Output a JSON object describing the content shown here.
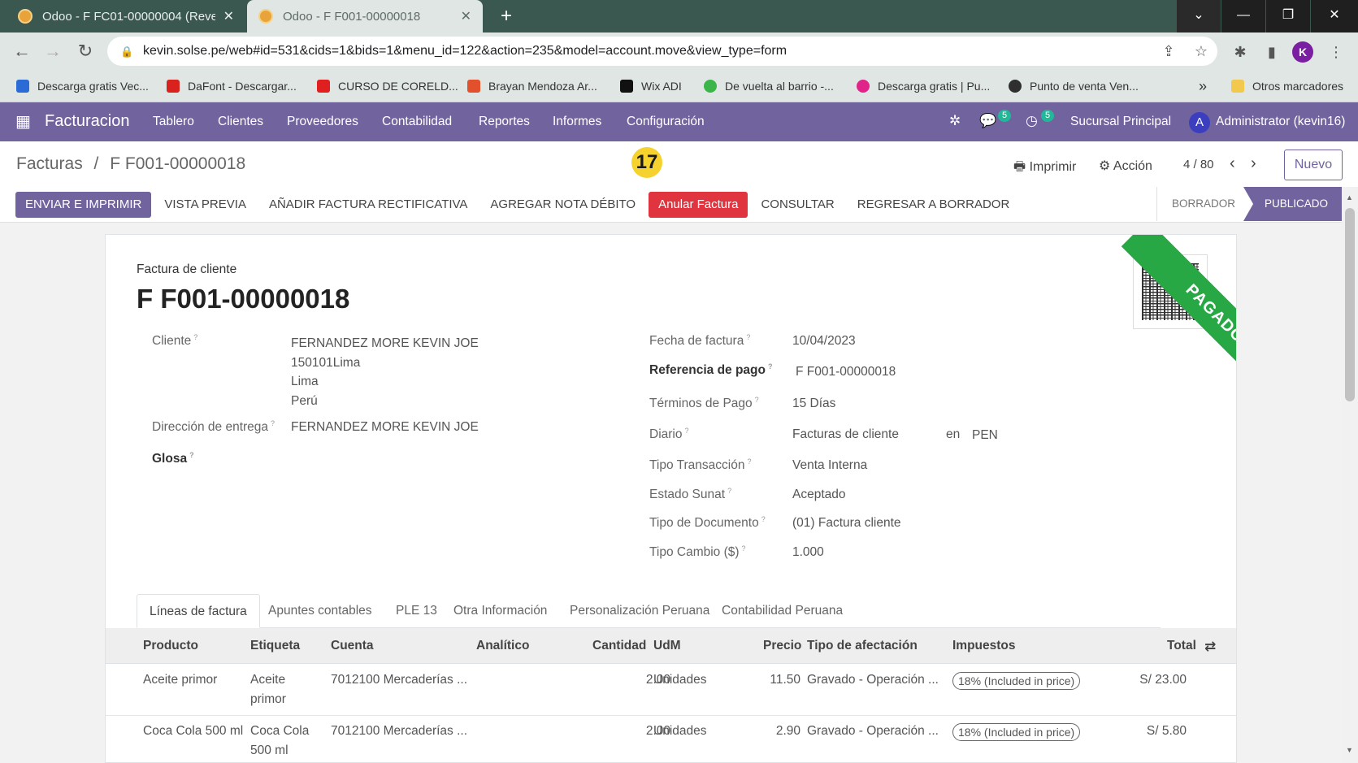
{
  "browser": {
    "tabs": [
      {
        "title": "Odoo - F FC01-00000004 (Revers",
        "active": false
      },
      {
        "title": "Odoo - F F001-00000018",
        "active": true
      }
    ],
    "url": "kevin.solse.pe/web#id=531&cids=1&bids=1&menu_id=122&action=235&model=account.move&view_type=form",
    "profile_initial": "K",
    "bookmarks": [
      {
        "label": "Descarga gratis Vec...",
        "color": "#2b6bd6"
      },
      {
        "label": "DaFont - Descargar...",
        "color": "#d9211d"
      },
      {
        "label": "CURSO DE CORELD...",
        "color": "#e02020"
      },
      {
        "label": "Brayan Mendoza Ar...",
        "color": "#e2512b"
      },
      {
        "label": "Wix ADI",
        "color": "#111111"
      },
      {
        "label": "De vuelta al barrio -...",
        "color": "#3ab54a"
      },
      {
        "label": "Descarga gratis | Pu...",
        "color": "#e0248a"
      },
      {
        "label": "Punto de venta Ven...",
        "color": "#2f2f2f"
      }
    ],
    "bookmarks_more": "»",
    "other_bookmarks": "Otros marcadores"
  },
  "odoo": {
    "app_name": "Facturacion",
    "menu": [
      "Tablero",
      "Clientes",
      "Proveedores",
      "Contabilidad",
      "Reportes",
      "Informes",
      "Configuración"
    ],
    "messages_count": "5",
    "activities_count": "5",
    "branch": "Sucursal Principal",
    "user_initial": "A",
    "user": "Administrator (kevin16)"
  },
  "control_panel": {
    "breadcrumb_parent": "Facturas",
    "breadcrumb_sep": "/",
    "breadcrumb_current": "F F001-00000018",
    "step_marker": "17",
    "print_label": "Imprimir",
    "action_label": "Acción",
    "pager": "4 / 80",
    "new_label": "Nuevo"
  },
  "action_buttons": {
    "send_print": "ENVIAR E IMPRIMIR",
    "preview": "VISTA PREVIA",
    "credit_note": "AÑADIR FACTURA RECTIFICATIVA",
    "debit_note": "AGREGAR NOTA DÉBITO",
    "cancel_invoice": "Anular Factura",
    "consult": "CONSULTAR",
    "reset_draft": "REGRESAR A BORRADOR"
  },
  "status": {
    "draft": "BORRADOR",
    "posted": "PUBLICADO"
  },
  "invoice": {
    "doc_type": "Factura de cliente",
    "name": "F F001-00000018",
    "ribbon": "PAGADO",
    "labels": {
      "customer": "Cliente",
      "delivery": "Dirección de entrega",
      "gloss": "Glosa",
      "invoice_date": "Fecha de factura",
      "payment_ref": "Referencia de pago",
      "payment_terms": "Términos de Pago",
      "journal": "Diario",
      "transaction_type": "Tipo Transacción",
      "sunat_state": "Estado Sunat",
      "document_type": "Tipo de Documento",
      "exchange_rate": "Tipo Cambio ($)"
    },
    "customer_name": "FERNANDEZ MORE KEVIN JOE",
    "customer_line1": "150101Lima",
    "customer_line2": "Lima",
    "customer_line3": "Perú",
    "delivery": "FERNANDEZ MORE KEVIN JOE",
    "invoice_date": "10/04/2023",
    "payment_ref": "F F001-00000018",
    "payment_terms": "15 Días",
    "journal": "Facturas de cliente",
    "journal_in": "en",
    "currency": "PEN",
    "transaction_type": "Venta Interna",
    "sunat_state": "Aceptado",
    "document_type": "(01) Factura cliente",
    "exchange_rate": "1.000"
  },
  "notebook": {
    "tabs": [
      "Líneas de factura",
      "Apuntes contables",
      "PLE 13",
      "Otra Información",
      "Personalización Peruana",
      "Contabilidad Peruana"
    ]
  },
  "lines": {
    "headers": {
      "product": "Producto",
      "label": "Etiqueta",
      "account": "Cuenta",
      "analytic": "Analítico",
      "quantity": "Cantidad",
      "uom": "UdM",
      "price": "Precio",
      "affect": "Tipo de afectación",
      "taxes": "Impuestos",
      "total": "Total"
    },
    "rows": [
      {
        "product": "Aceite primor",
        "label_l1": "Aceite",
        "label_l2": "primor",
        "account": "7012100 Mercaderías ...",
        "quantity": "2.00",
        "uom": "Unidades",
        "price": "11.50",
        "affect": "Gravado - Operación ...",
        "tax": "18% (Included in price)",
        "total": "S/ 23.00"
      },
      {
        "product": "Coca Cola 500 ml",
        "label_l1": "Coca Cola",
        "label_l2": "500 ml",
        "account": "7012100 Mercaderías ...",
        "quantity": "2.00",
        "uom": "Unidades",
        "price": "2.90",
        "affect": "Gravado - Operación ...",
        "tax": "18% (Included in price)",
        "total": "S/ 5.80"
      }
    ]
  },
  "colors": {
    "brand": "#71639e",
    "danger": "#e0343e",
    "paid": "#28a745"
  }
}
